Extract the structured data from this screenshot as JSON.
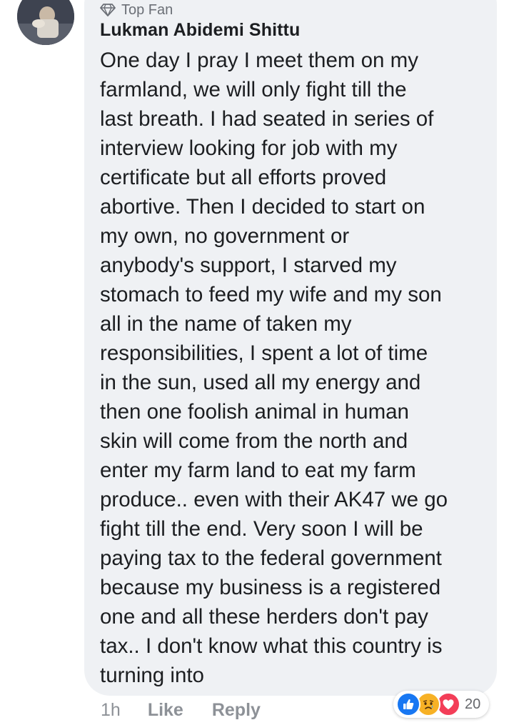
{
  "comment": {
    "badge": "Top Fan",
    "author": "Lukman Abidemi Shittu",
    "text": "One day I pray I meet them on my\nfarmland, we will only fight till the\nlast breath.  I had seated in series of\ninterview looking for job with my\ncertificate but all efforts proved\nabortive. Then I decided to start on\nmy own,  no government or\nanybody's support,  I starved my\nstomach to feed my wife and my son\nall in the name of taken my\nresponsibilities, I spent a lot of time\nin the sun,  used all my energy and\nthen one foolish animal in human\nskin will come from the north and\nenter my farm land to eat my farm\nproduce.. even with their AK47 we go\nfight till the end. Very soon I will be\npaying tax to the federal government\nbecause my business is a registered\none and all these herders don't pay\ntax.. I don't know what this country is\nturning into"
  },
  "actions": {
    "time": "1h",
    "like_label": "Like",
    "reply_label": "Reply"
  },
  "reactions": {
    "icons": [
      "like-icon",
      "sad-icon",
      "love-icon"
    ],
    "count": "20",
    "colors": {
      "like": "#1877f2",
      "sad": "#f7b125",
      "love": "#f33e58"
    }
  },
  "colors": {
    "bubble": "#eff1f4",
    "text": "#1c1e21",
    "muted": "#8d9197"
  }
}
